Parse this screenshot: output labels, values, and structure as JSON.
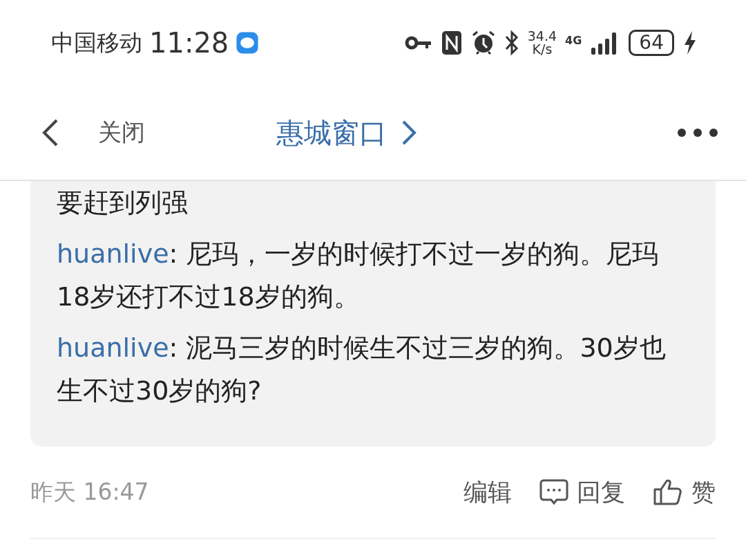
{
  "status_bar": {
    "carrier": "中国移动",
    "time": "11:28",
    "speed_value": "34.4",
    "speed_unit": "K/s",
    "network": "4G",
    "battery": "64"
  },
  "header": {
    "close": "关闭",
    "title": "惠城窗口"
  },
  "quote": {
    "lines": [
      {
        "kind": "text",
        "text": "要赶到列强"
      },
      {
        "kind": "comment",
        "user": "huanlive",
        "text": ": 尼玛，一岁的时候打不过一岁的狗。尼玛18岁还打不过18岁的狗。"
      },
      {
        "kind": "comment",
        "user": "huanlive",
        "text": ": 泥马三岁的时候生不过三岁的狗。30岁也生不过30岁的狗?"
      }
    ]
  },
  "footer": {
    "time": "昨天 16:47",
    "edit": "编辑",
    "reply": "回复",
    "like": "赞"
  }
}
